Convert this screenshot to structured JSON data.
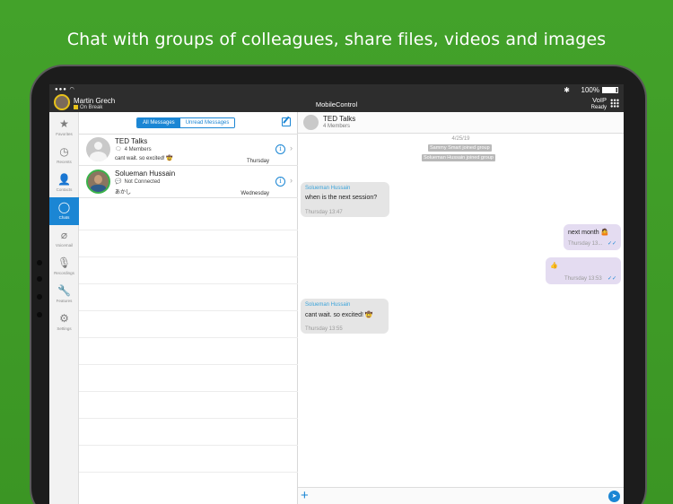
{
  "headline": "Chat with groups of colleagues, share files, videos and images",
  "status_bar": {
    "battery": "100%"
  },
  "user": {
    "name": "Martin Grech",
    "status": "On Break"
  },
  "app_title": "MobileControl",
  "voip": {
    "label": "VoIP",
    "status": "Ready"
  },
  "sidebar": {
    "items": [
      {
        "label": "Favorites",
        "icon": "star-icon",
        "glyph": "★"
      },
      {
        "label": "Recents",
        "icon": "clock-icon",
        "glyph": "◷"
      },
      {
        "label": "Contacts",
        "icon": "person-icon",
        "glyph": "👤"
      },
      {
        "label": "Chats",
        "icon": "chat-bubble-icon",
        "glyph": "◯"
      },
      {
        "label": "Voicemail",
        "icon": "voicemail-icon",
        "glyph": "⌀"
      },
      {
        "label": "Recordings",
        "icon": "microphone-icon",
        "glyph": "🎙"
      },
      {
        "label": "Features",
        "icon": "wrench-icon",
        "glyph": "🔧"
      },
      {
        "label": "Settings",
        "icon": "gear-icon",
        "glyph": "⚙"
      }
    ],
    "active": "Chats"
  },
  "chat_list": {
    "tabs": [
      "All Messages",
      "Unread Messages"
    ],
    "items": [
      {
        "name": "TED Talks",
        "sub": "4 Members",
        "message": "cant wait. so excited! 🤠",
        "time": "Thursday"
      },
      {
        "name": "Solueman Hussain",
        "sub": "Not Connected",
        "message": "あかし",
        "time": "Wednesday"
      }
    ]
  },
  "conversation": {
    "title": "TED Talks",
    "subtitle": "4 Members",
    "date": "4/25/19",
    "system_messages": [
      "Sammy Smart joined group",
      "Solueman Hussain joined group"
    ],
    "messages": [
      {
        "direction": "in",
        "sender": "Solueman Hussain",
        "text": "when is the next session?",
        "time": "Thursday   13:47"
      },
      {
        "direction": "out",
        "text": "next month 🤷",
        "time": "Thursday   13..."
      },
      {
        "direction": "out",
        "text": "👍",
        "time": "Thursday   13:53"
      },
      {
        "direction": "in",
        "sender": "Solueman Hussain",
        "text": "cant wait. so excited! 🤠",
        "time": "Thursday   13:55"
      }
    ]
  },
  "colors": {
    "accent": "#1b86d4",
    "background": "#43a22a",
    "outgoing_bubble": "#e4dcf1",
    "incoming_bubble": "#e5e5e5"
  }
}
